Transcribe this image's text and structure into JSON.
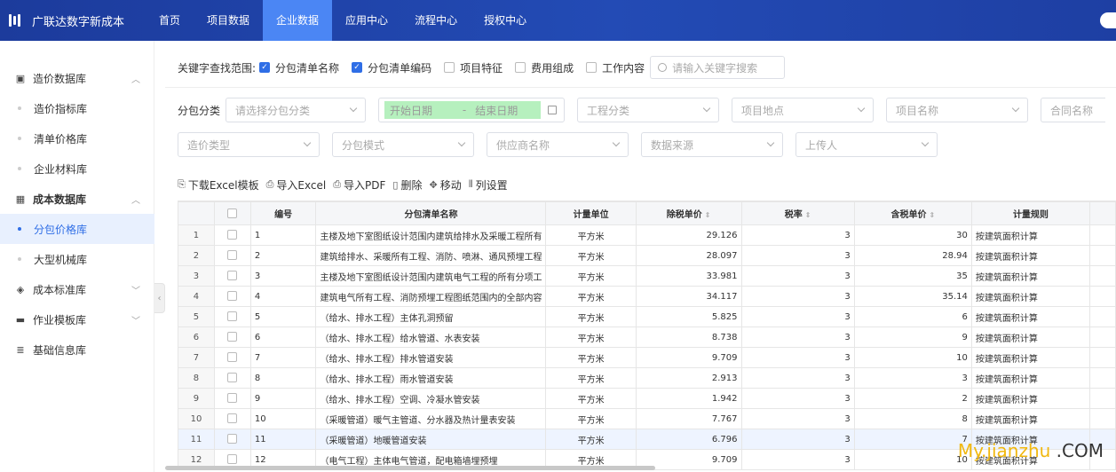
{
  "app": {
    "title": "广联达数字新成本"
  },
  "nav": {
    "items": [
      {
        "label": "首页",
        "active": false
      },
      {
        "label": "项目数据",
        "active": false
      },
      {
        "label": "企业数据",
        "active": true
      },
      {
        "label": "应用中心",
        "active": false
      },
      {
        "label": "流程中心",
        "active": false
      },
      {
        "label": "授权中心",
        "active": false
      }
    ]
  },
  "sidebar": {
    "groups": [
      {
        "label": "造价数据库",
        "icon": "database-icon",
        "expanded": true,
        "items": [
          {
            "label": "造价指标库"
          },
          {
            "label": "清单价格库"
          },
          {
            "label": "企业材料库"
          }
        ]
      },
      {
        "label": "成本数据库",
        "icon": "table-icon",
        "expanded": true,
        "items": [
          {
            "label": "分包价格库",
            "active": true
          },
          {
            "label": "大型机械库"
          }
        ]
      },
      {
        "label": "成本标准库",
        "icon": "cube-icon",
        "expanded": false,
        "items": []
      },
      {
        "label": "作业模板库",
        "icon": "monitor-icon",
        "expanded": false,
        "items": []
      },
      {
        "label": "基础信息库",
        "icon": "stack-icon",
        "expanded": false,
        "items": []
      }
    ]
  },
  "keyword_filter": {
    "label": "关键字查找范围:",
    "options": [
      {
        "label": "分包清单名称",
        "checked": true
      },
      {
        "label": "分包清单编码",
        "checked": true
      },
      {
        "label": "项目特征",
        "checked": false
      },
      {
        "label": "费用组成",
        "checked": false
      },
      {
        "label": "工作内容",
        "checked": false
      }
    ],
    "search_placeholder": "请输入关键字搜索"
  },
  "filters": {
    "label": "分包分类",
    "category_placeholder": "请选择分包分类",
    "start_date": "开始日期",
    "date_sep": "-",
    "end_date": "结束日期",
    "project_type": "工程分类",
    "project_location": "项目地点",
    "project_name": "项目名称",
    "contract_name": "合同名称",
    "cost_type": "造价类型",
    "subcontract_mode": "分包模式",
    "supplier_name": "供应商名称",
    "data_source": "数据来源",
    "uploader": "上传人"
  },
  "toolbar": {
    "download_template": "下载Excel模板",
    "import_excel": "导入Excel",
    "import_pdf": "导入PDF",
    "delete": "删除",
    "move": "移动",
    "column_settings": "列设置"
  },
  "table": {
    "headers": {
      "code": "编号",
      "name": "分包清单名称",
      "unit": "计量单位",
      "price_ex_tax": "除税单价",
      "tax_rate": "税率",
      "price_inc_tax": "含税单价",
      "rule": "计量规则"
    },
    "rows": [
      {
        "idx": "1",
        "code": "1",
        "name": "主楼及地下室图纸设计范围内建筑给排水及采暖工程所有",
        "unit": "平方米",
        "ex": "29.126",
        "tax": "3",
        "inc": "30",
        "rule": "按建筑面积计算"
      },
      {
        "idx": "2",
        "code": "2",
        "name": "建筑给排水、采暖所有工程、消防、喷淋、通风预埋工程",
        "unit": "平方米",
        "ex": "28.097",
        "tax": "3",
        "inc": "28.94",
        "rule": "按建筑面积计算"
      },
      {
        "idx": "3",
        "code": "3",
        "name": "主楼及地下室图纸设计范围内建筑电气工程的所有分项工",
        "unit": "平方米",
        "ex": "33.981",
        "tax": "3",
        "inc": "35",
        "rule": "按建筑面积计算"
      },
      {
        "idx": "4",
        "code": "4",
        "name": "建筑电气所有工程、消防预埋工程图纸范围内的全部内容",
        "unit": "平方米",
        "ex": "34.117",
        "tax": "3",
        "inc": "35.14",
        "rule": "按建筑面积计算"
      },
      {
        "idx": "5",
        "code": "5",
        "name": "（给水、排水工程）主体孔洞预留",
        "unit": "平方米",
        "ex": "5.825",
        "tax": "3",
        "inc": "6",
        "rule": "按建筑面积计算"
      },
      {
        "idx": "6",
        "code": "6",
        "name": "（给水、排水工程）给水管道、水表安装",
        "unit": "平方米",
        "ex": "8.738",
        "tax": "3",
        "inc": "9",
        "rule": "按建筑面积计算"
      },
      {
        "idx": "7",
        "code": "7",
        "name": "（给水、排水工程）排水管道安装",
        "unit": "平方米",
        "ex": "9.709",
        "tax": "3",
        "inc": "10",
        "rule": "按建筑面积计算"
      },
      {
        "idx": "8",
        "code": "8",
        "name": "（给水、排水工程）雨水管道安装",
        "unit": "平方米",
        "ex": "2.913",
        "tax": "3",
        "inc": "3",
        "rule": "按建筑面积计算"
      },
      {
        "idx": "9",
        "code": "9",
        "name": "（给水、排水工程）空调、冷凝水管安装",
        "unit": "平方米",
        "ex": "1.942",
        "tax": "3",
        "inc": "2",
        "rule": "按建筑面积计算"
      },
      {
        "idx": "10",
        "code": "10",
        "name": "（采暖管道）暖气主管道、分水器及热计量表安装",
        "unit": "平方米",
        "ex": "7.767",
        "tax": "3",
        "inc": "8",
        "rule": "按建筑面积计算"
      },
      {
        "idx": "11",
        "code": "11",
        "name": "（采暖管道）地暖管道安装",
        "unit": "平方米",
        "ex": "6.796",
        "tax": "3",
        "inc": "7",
        "rule": "按建筑面积计算"
      },
      {
        "idx": "12",
        "code": "12",
        "name": "（电气工程）主体电气管道，配电箱墙埋预埋",
        "unit": "平方米",
        "ex": "9.709",
        "tax": "3",
        "inc": "10",
        "rule": "按建筑面积计算"
      }
    ]
  },
  "watermark": {
    "part_a": "My.jianzhu",
    "part_b": " .COM"
  },
  "colors": {
    "nav_bg": "#234bb5",
    "nav_active": "#4b86f4",
    "accent": "#2f6ee6",
    "date_highlight": "#b6f0be"
  }
}
